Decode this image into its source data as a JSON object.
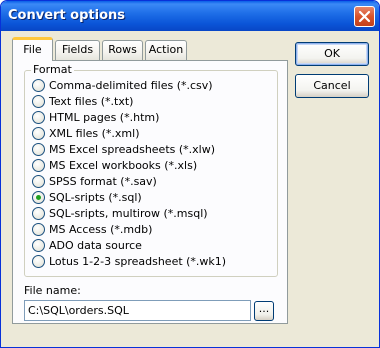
{
  "window": {
    "title": "Convert options",
    "close_symbol": "×"
  },
  "tabs": [
    {
      "label": "File",
      "active": true
    },
    {
      "label": "Fields",
      "active": false
    },
    {
      "label": "Rows",
      "active": false
    },
    {
      "label": "Action",
      "active": false
    }
  ],
  "format": {
    "legend": "Format",
    "options": [
      {
        "label": "Comma-delimited files (*.csv)",
        "checked": false
      },
      {
        "label": "Text files (*.txt)",
        "checked": false
      },
      {
        "label": "HTML pages (*.htm)",
        "checked": false
      },
      {
        "label": "XML files (*.xml)",
        "checked": false
      },
      {
        "label": "MS Excel spreadsheets (*.xlw)",
        "checked": false
      },
      {
        "label": "MS Excel workbooks (*.xls)",
        "checked": false
      },
      {
        "label": "SPSS format (*.sav)",
        "checked": false
      },
      {
        "label": "SQL-sripts (*.sql)",
        "checked": true
      },
      {
        "label": "SQL-sripts, multirow (*.msql)",
        "checked": false
      },
      {
        "label": "MS Access (*.mdb)",
        "checked": false
      },
      {
        "label": "ADO data source",
        "checked": false
      },
      {
        "label": "Lotus 1-2-3 spreadsheet (*.wk1)",
        "checked": false
      }
    ]
  },
  "file": {
    "label": "File name:",
    "value": "C:\\SQL\\orders.SQL",
    "browse_label": "..."
  },
  "buttons": {
    "ok": "OK",
    "cancel": "Cancel"
  },
  "colors": {
    "titlebar": "#0a5fe8",
    "dialog_bg": "#ece9d8",
    "tab_highlight": "#ffc83c",
    "radio_dot": "#21a121"
  }
}
